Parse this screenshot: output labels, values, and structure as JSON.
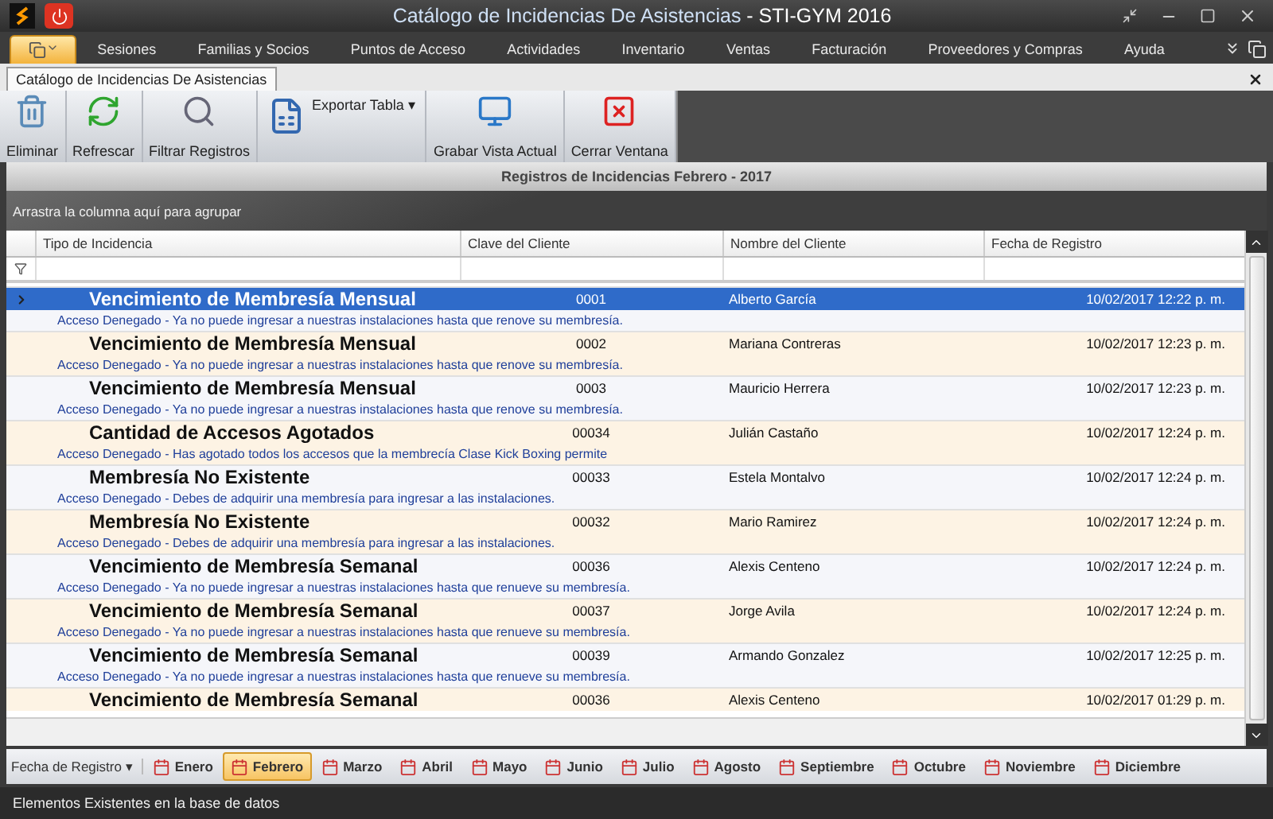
{
  "window": {
    "title_main": "Catálogo de Incidencias De Asistencias",
    "title_app": " - STI-GYM 2016"
  },
  "menu": [
    "Sesiones",
    "Familias y Socios",
    "Puntos de Acceso",
    "Actividades",
    "Inventario",
    "Ventas",
    "Facturación",
    "Proveedores y Compras",
    "Ayuda"
  ],
  "doc_tab": "Catálogo de Incidencias De Asistencias",
  "toolbar": [
    {
      "kind": "trash",
      "label": "Eliminar"
    },
    {
      "kind": "refresh",
      "label": "Refrescar"
    },
    {
      "kind": "filter",
      "label": "Filtrar Registros"
    },
    {
      "kind": "export",
      "label": "Exportar Tabla",
      "caret": "▾"
    },
    {
      "kind": "save",
      "label": "Grabar Vista Actual"
    },
    {
      "kind": "close",
      "label": "Cerrar Ventana"
    }
  ],
  "grid": {
    "title": "Registros de Incidencias Febrero - 2017",
    "group_hint": "Arrastra la columna aquí para agrupar",
    "columns": [
      "Tipo de Incidencia",
      "Clave del Cliente",
      "Nombre del Cliente",
      "Fecha de Registro"
    ],
    "rows": [
      {
        "type": "Vencimiento de Membresía Mensual",
        "key": "0001",
        "name": "Alberto García",
        "date": "10/02/2017 12:22 p. m.",
        "description": "Acceso Denegado - Ya no puede ingresar a nuestras instalaciones hasta que renove su membresía.",
        "selected": true
      },
      {
        "type": "Vencimiento de Membresía Mensual",
        "key": "0002",
        "name": "Mariana Contreras",
        "date": "10/02/2017 12:23 p. m.",
        "description": "Acceso Denegado - Ya no puede ingresar a nuestras instalaciones hasta que renove su membresía.",
        "selected": false
      },
      {
        "type": "Vencimiento de Membresía Mensual",
        "key": "0003",
        "name": "Mauricio Herrera",
        "date": "10/02/2017 12:23 p. m.",
        "description": "Acceso Denegado - Ya no puede ingresar a nuestras instalaciones hasta que renove su membresía.",
        "selected": false
      },
      {
        "type": "Cantidad de Accesos Agotados",
        "key": "00034",
        "name": "Julián Castaño",
        "date": "10/02/2017 12:24 p. m.",
        "description": "Acceso Denegado - Has agotado todos los accesos que la membrecía Clase Kick Boxing permite",
        "selected": false
      },
      {
        "type": "Membresía No Existente",
        "key": "00033",
        "name": "Estela Montalvo",
        "date": "10/02/2017 12:24 p. m.",
        "description": "Acceso Denegado - Debes de adquirir una membresía para ingresar a las instalaciones.",
        "selected": false
      },
      {
        "type": "Membresía No Existente",
        "key": "00032",
        "name": "Mario Ramirez",
        "date": "10/02/2017 12:24 p. m.",
        "description": "Acceso Denegado - Debes de adquirir una membresía para ingresar a las instalaciones.",
        "selected": false
      },
      {
        "type": "Vencimiento de Membresía Semanal",
        "key": "00036",
        "name": "Alexis Centeno",
        "date": "10/02/2017 12:24 p. m.",
        "description": "Acceso Denegado - Ya no puede ingresar a nuestras instalaciones hasta que renueve su membresía.",
        "selected": false
      },
      {
        "type": "Vencimiento de Membresía Semanal",
        "key": "00037",
        "name": "Jorge Avila",
        "date": "10/02/2017 12:24 p. m.",
        "description": "Acceso Denegado - Ya no puede ingresar a nuestras instalaciones hasta que renueve su membresía.",
        "selected": false
      },
      {
        "type": "Vencimiento de Membresía Semanal",
        "key": "00039",
        "name": "Armando Gonzalez",
        "date": "10/02/2017 12:25 p. m.",
        "description": "Acceso Denegado - Ya no puede ingresar a nuestras instalaciones hasta que renueve su membresía.",
        "selected": false
      },
      {
        "type": "Vencimiento de Membresía Semanal",
        "key": "00036",
        "name": "Alexis Centeno",
        "date": "10/02/2017 01:29 p. m.",
        "selected": false
      }
    ]
  },
  "month_bar": {
    "field": "Fecha de Registro",
    "field_caret": "▾",
    "months": [
      {
        "label": "Enero",
        "selected": false
      },
      {
        "label": "Febrero",
        "selected": true
      },
      {
        "label": "Marzo",
        "selected": false
      },
      {
        "label": "Abril",
        "selected": false
      },
      {
        "label": "Mayo",
        "selected": false
      },
      {
        "label": "Junio",
        "selected": false
      },
      {
        "label": "Julio",
        "selected": false
      },
      {
        "label": "Agosto",
        "selected": false
      },
      {
        "label": "Septiembre",
        "selected": false
      },
      {
        "label": "Octubre",
        "selected": false
      },
      {
        "label": "Noviembre",
        "selected": false
      },
      {
        "label": "Diciembre",
        "selected": false
      }
    ]
  },
  "status_bar": "Elementos Existentes en la base de datos"
}
